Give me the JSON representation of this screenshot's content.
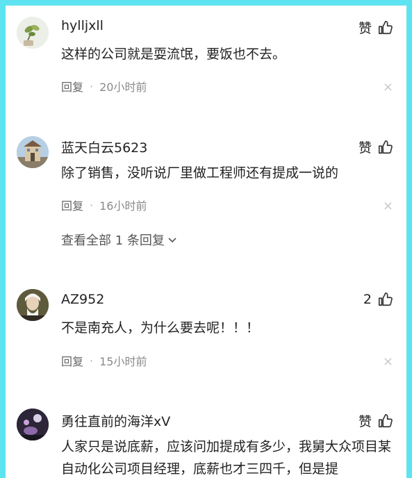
{
  "colors": {
    "frame": "#5ee3f0",
    "text": "#222222",
    "meta": "#8a8a8a"
  },
  "comments": [
    {
      "username": "hylljxll",
      "like_label": "赞",
      "text": "这样的公司就是耍流氓，要饭也不去。",
      "reply_label": "回复",
      "time": "20小时前",
      "avatar_icon": "plant-avatar"
    },
    {
      "username": "蓝天白云5623",
      "like_label": "赞",
      "text": "除了销售，没听说厂里做工程师还有提成一说的",
      "reply_label": "回复",
      "time": "16小时前",
      "view_replies": "查看全部 1 条回复",
      "avatar_icon": "building-avatar"
    },
    {
      "username": "AZ952",
      "like_label": "2",
      "text": "不是南充人，为什么要去呢！！！",
      "reply_label": "回复",
      "time": "15小时前",
      "avatar_icon": "portrait-avatar"
    },
    {
      "username": "勇往直前的海洋xV",
      "like_label": "赞",
      "text": "人家只是说底薪，应该问加提成有多少，我舅大众项目某自动化公司项目经理，底薪也才三四千，但是提",
      "avatar_icon": "night-avatar"
    }
  ]
}
